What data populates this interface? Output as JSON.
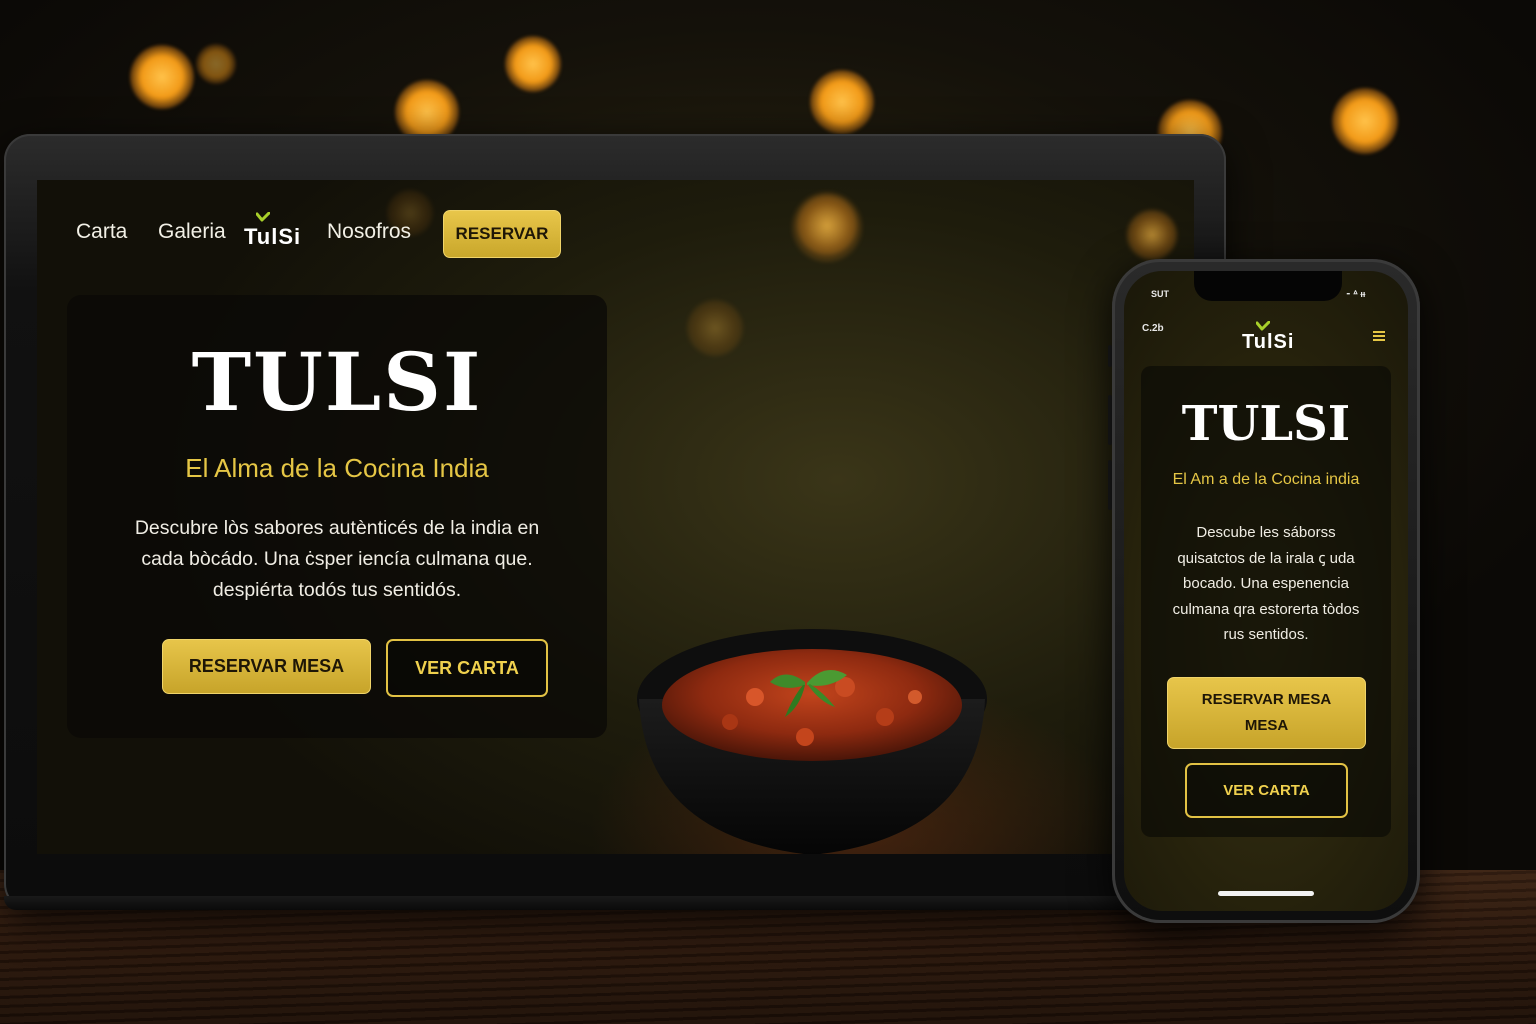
{
  "colors": {
    "accent_gold": "#e5c645",
    "button_gold": "#d8b63a",
    "card_bg": "#0c0b06",
    "text_light": "#f0ede4"
  },
  "laptop": {
    "nav": {
      "links": [
        "Carta",
        "Galeria",
        "Nosofros"
      ],
      "logo": "TulSi",
      "reserve_button": "RESERVAR"
    },
    "hero": {
      "title": "TULSI",
      "subtitle": "El Alma de la Cocina India",
      "description_lines": [
        "Descubre lòs sabores autènticés de la india en",
        "cada bòcádo. Una ċsper iencía culmana que.",
        "despiérta todós tus sentidós."
      ],
      "primary_button": "RESERVAR MESA",
      "secondary_button": "VER CARTA"
    }
  },
  "phone": {
    "status": {
      "left": "SUT",
      "right": "⁃ ᐞ ᵻᵻ",
      "time": "C.2b"
    },
    "logo": "TulSi",
    "menu_icon": "hamburger-icon",
    "hero": {
      "title": "TULSI",
      "subtitle": "El Am a de la Cocina india",
      "description_lines": [
        "Descube les sáborss",
        "quisatctos de la irala ꞔ uda",
        "bocado.  Una espenencia",
        "culmana qra estorerta tòdos",
        "rus sentidos."
      ],
      "primary_button_lines": [
        "RESERVAR MESA",
        "MESA"
      ],
      "secondary_button": "VER CARTA"
    }
  }
}
